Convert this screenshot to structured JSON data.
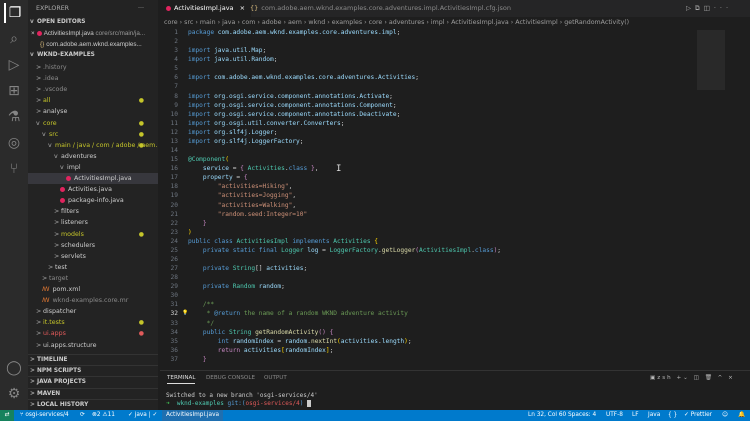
{
  "activity_bar": [
    "files-icon",
    "search-icon",
    "run-debug-icon",
    "extensions-icon",
    "testing-icon",
    "remote-icon",
    "source-control-icon"
  ],
  "sidebar": {
    "title": "EXPLORER",
    "open_editors_header": "OPEN EDITORS",
    "open_editors": [
      {
        "name": "ActivitiesImpl.java",
        "desc": "core/src/main/ja..."
      },
      {
        "name": "com.adobe.aem.wknd.examples..."
      }
    ],
    "project_header": "WKND-EXAMPLES",
    "tree": [
      {
        "label": ".history",
        "d": 1,
        "chev": ">",
        "color": "#8a8a8a"
      },
      {
        "label": ".idea",
        "d": 1,
        "chev": ">",
        "color": "#8a8a8a"
      },
      {
        "label": ".vscode",
        "d": 1,
        "chev": ">",
        "color": "#8a8a8a"
      },
      {
        "label": "all",
        "d": 1,
        "chev": ">",
        "color": "#c5c52a",
        "dot": true
      },
      {
        "label": "analyse",
        "d": 1,
        "chev": ">",
        "color": "#ccc"
      },
      {
        "label": "core",
        "d": 1,
        "chev": "v",
        "color": "#c5c52a",
        "dot": true
      },
      {
        "label": "src",
        "d": 2,
        "chev": "v",
        "color": "#c5c52a",
        "dot": true
      },
      {
        "label": "main / java / com / adobe / aem...",
        "d": 3,
        "chev": "v",
        "color": "#c5c52a",
        "dot": true
      },
      {
        "label": "adventures",
        "d": 4,
        "chev": "v",
        "color": "#ccc"
      },
      {
        "label": "impl",
        "d": 5,
        "chev": "v",
        "color": "#ccc"
      },
      {
        "label": "ActivitiesImpl.java",
        "d": 6,
        "file": true,
        "color": "#ccc",
        "sel": true
      },
      {
        "label": "Activities.java",
        "d": 5,
        "file": true,
        "color": "#ccc"
      },
      {
        "label": "package-info.java",
        "d": 5,
        "file": true,
        "color": "#ccc"
      },
      {
        "label": "filters",
        "d": 4,
        "chev": ">",
        "color": "#ccc"
      },
      {
        "label": "listeners",
        "d": 4,
        "chev": ">",
        "color": "#ccc"
      },
      {
        "label": "models",
        "d": 4,
        "chev": ">",
        "color": "#c5c52a",
        "dot": true
      },
      {
        "label": "schedulers",
        "d": 4,
        "chev": ">",
        "color": "#ccc"
      },
      {
        "label": "servlets",
        "d": 4,
        "chev": ">",
        "color": "#ccc"
      },
      {
        "label": "test",
        "d": 3,
        "chev": ">",
        "color": "#ccc"
      },
      {
        "label": "target",
        "d": 2,
        "chev": ">",
        "color": "#8a8a8a"
      },
      {
        "label": "pom.xml",
        "d": 2,
        "xml": true,
        "color": "#ccc"
      },
      {
        "label": "wknd-examples.core.mr",
        "d": 2,
        "xml": true,
        "color": "#8a8a8a"
      },
      {
        "label": "dispatcher",
        "d": 1,
        "chev": ">",
        "color": "#ccc"
      },
      {
        "label": "it.tests",
        "d": 1,
        "chev": ">",
        "color": "#c5c52a",
        "dot": true
      },
      {
        "label": "ui.apps",
        "d": 1,
        "chev": ">",
        "color": "#e05a5a",
        "dot": true
      },
      {
        "label": "ui.apps.structure",
        "d": 1,
        "chev": ">",
        "color": "#ccc"
      }
    ],
    "sections": [
      "TIMELINE",
      "NPM SCRIPTS",
      "JAVA PROJECTS",
      "MAVEN",
      "LOCAL HISTORY"
    ]
  },
  "tabs": [
    {
      "label": "ActivitiesImpl.java",
      "active": true
    },
    {
      "label": "com.adobe.aem.wknd.examples.core.adventures.impl.ActivitiesImpl.cfg.json"
    }
  ],
  "breadcrumb": [
    "core",
    "src",
    "main",
    "java",
    "com",
    "adobe",
    "aem",
    "wknd",
    "examples",
    "core",
    "adventures",
    "impl",
    "ActivitiesImpl.java",
    "ActivitiesImpl",
    "getRandomActivity()"
  ],
  "current_line": 32,
  "code": [
    [
      [
        "k",
        "package"
      ],
      [
        "v",
        " com.adobe.aem.wknd.examples.core.adventures.impl"
      ],
      [
        "p",
        ";"
      ]
    ],
    [],
    [
      [
        "k",
        "import"
      ],
      [
        "v",
        " java.util.Map"
      ],
      [
        "p",
        ";"
      ]
    ],
    [
      [
        "k",
        "import"
      ],
      [
        "v",
        " java.util.Random"
      ],
      [
        "p",
        ";"
      ]
    ],
    [],
    [
      [
        "k",
        "import"
      ],
      [
        "v",
        " com.adobe.aem.wknd.examples.core.adventures.Activities"
      ],
      [
        "p",
        ";"
      ]
    ],
    [],
    [
      [
        "k",
        "import"
      ],
      [
        "v",
        " org.osgi.service.component.annotations.Activate"
      ],
      [
        "p",
        ";"
      ]
    ],
    [
      [
        "k",
        "import"
      ],
      [
        "v",
        " org.osgi.service.component.annotations.Component"
      ],
      [
        "p",
        ";"
      ]
    ],
    [
      [
        "k",
        "import"
      ],
      [
        "v",
        " org.osgi.service.component.annotations.Deactivate"
      ],
      [
        "p",
        ";"
      ]
    ],
    [
      [
        "k",
        "import"
      ],
      [
        "v",
        " org.osgi.util.converter.Converters"
      ],
      [
        "p",
        ";"
      ]
    ],
    [
      [
        "k",
        "import"
      ],
      [
        "v",
        " org.slf4j.Logger"
      ],
      [
        "p",
        ";"
      ]
    ],
    [
      [
        "k",
        "import"
      ],
      [
        "v",
        " org.slf4j.LoggerFactory"
      ],
      [
        "p",
        ";"
      ]
    ],
    [],
    [
      [
        "a",
        "@Component"
      ],
      [
        "y",
        "("
      ]
    ],
    [
      [
        "v",
        "    service"
      ],
      [
        "p",
        " = "
      ],
      [
        "cr",
        "{ "
      ],
      [
        "ty",
        "Activities"
      ],
      [
        "p",
        "."
      ],
      [
        "k",
        "class"
      ],
      [
        "cr",
        " }"
      ],
      [
        "p",
        ","
      ]
    ],
    [
      [
        "v",
        "    property"
      ],
      [
        "p",
        " = "
      ],
      [
        "cr",
        "{"
      ]
    ],
    [
      [
        "s",
        "        \"activities=Hiking\""
      ],
      [
        "p",
        ","
      ]
    ],
    [
      [
        "s",
        "        \"activities=Jogging\""
      ],
      [
        "p",
        ","
      ]
    ],
    [
      [
        "s",
        "        \"activities=Walking\""
      ],
      [
        "p",
        ","
      ]
    ],
    [
      [
        "s",
        "        \"random.seed:Integer=10\""
      ]
    ],
    [
      [
        "cr",
        "    }"
      ]
    ],
    [
      [
        "y",
        ")"
      ]
    ],
    [
      [
        "k",
        "public class "
      ],
      [
        "ty",
        "ActivitiesImpl"
      ],
      [
        "k",
        " implements "
      ],
      [
        "ty",
        "Activities"
      ],
      [
        "y",
        " {"
      ]
    ],
    [
      [
        "k",
        "    private static final "
      ],
      [
        "ty",
        "Logger"
      ],
      [
        "v",
        " log"
      ],
      [
        "p",
        " = "
      ],
      [
        "ty",
        "LoggerFactory"
      ],
      [
        "p",
        "."
      ],
      [
        "f",
        "getLogger"
      ],
      [
        "cr",
        "("
      ],
      [
        "ty",
        "ActivitiesImpl"
      ],
      [
        "p",
        "."
      ],
      [
        "k",
        "class"
      ],
      [
        "cr",
        ")"
      ],
      [
        "p",
        ";"
      ]
    ],
    [],
    [
      [
        "k",
        "    private "
      ],
      [
        "ty",
        "String"
      ],
      [
        "p",
        "[] "
      ],
      [
        "v",
        "activities"
      ],
      [
        "p",
        ";"
      ]
    ],
    [],
    [
      [
        "k",
        "    private "
      ],
      [
        "ty",
        "Random"
      ],
      [
        "v",
        " random"
      ],
      [
        "p",
        ";"
      ]
    ],
    [],
    [
      [
        "c",
        "    /**"
      ]
    ],
    [
      [
        "c",
        "     * "
      ],
      [
        "k",
        "@return"
      ],
      [
        "c",
        " the name of a random WKND adventure activity"
      ]
    ],
    [
      [
        "c",
        "     */"
      ]
    ],
    [
      [
        "k",
        "    public "
      ],
      [
        "ty",
        "String"
      ],
      [
        "f",
        " getRandomActivity"
      ],
      [
        "cr",
        "()"
      ],
      [
        "cr",
        " {"
      ]
    ],
    [
      [
        "k",
        "        int"
      ],
      [
        "v",
        " randomIndex"
      ],
      [
        "p",
        " = "
      ],
      [
        "v",
        "random"
      ],
      [
        "p",
        "."
      ],
      [
        "f",
        "nextInt"
      ],
      [
        "y",
        "("
      ],
      [
        "v",
        "activities"
      ],
      [
        "p",
        "."
      ],
      [
        "v",
        "length"
      ],
      [
        "y",
        ")"
      ],
      [
        "p",
        ";"
      ]
    ],
    [
      [
        "cr",
        "        return"
      ],
      [
        "v",
        " activities"
      ],
      [
        "y",
        "["
      ],
      [
        "v",
        "randomIndex"
      ],
      [
        "y",
        "]"
      ],
      [
        "p",
        ";"
      ]
    ],
    [
      [
        "cr",
        "    }"
      ]
    ]
  ],
  "panel": {
    "tabs": [
      "TERMINAL",
      "DEBUG CONSOLE",
      "OUTPUT"
    ],
    "shell": "zsh",
    "terminal_line1": "Switched to a new branch 'osgi-services/4'",
    "prompt_arrow": "➜",
    "prompt_dir": "wknd-examples",
    "prompt_git": "git:(",
    "prompt_branch": "osgi-services/4",
    "prompt_end": ")"
  },
  "status": {
    "branch": "osgi-services/4",
    "errors": "2",
    "warnings": "11",
    "java": "java",
    "file": "ActivitiesImpl.java",
    "position": "Ln 32, Col 60",
    "spaces": "Spaces: 4",
    "encoding": "UTF-8",
    "eol": "LF",
    "language": "Java",
    "prettier": "Prettier",
    "accent": "#007acc"
  }
}
